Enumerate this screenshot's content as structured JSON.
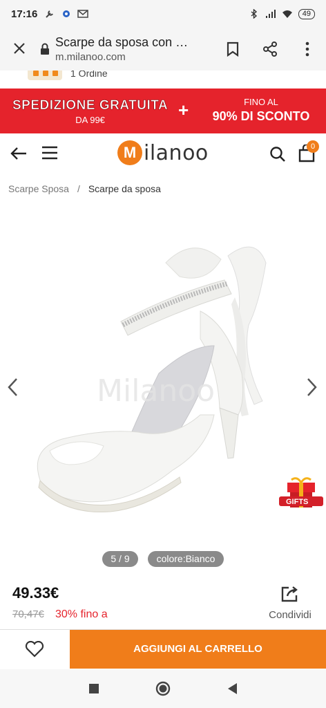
{
  "status_bar": {
    "time": "17:16",
    "battery": "49"
  },
  "browser": {
    "page_title": "Scarpe da sposa con …",
    "domain": "m.milanoo.com"
  },
  "strip": {
    "text": "1 Ordine"
  },
  "promo": {
    "free_shipping": "SPEDIZIONE GRATUITA",
    "threshold": "DA 99€",
    "plus": "+",
    "up_to": "FINO AL",
    "discount": "90% DI SCONTO"
  },
  "header": {
    "logo_text": "ilanoo"
  },
  "breadcrumb": {
    "items": [
      "Scarpe Sposa",
      "/",
      "Scarpe da sposa"
    ]
  },
  "gallery": {
    "counter": "5 / 9",
    "color_label": "colore:Bianco",
    "gifts_label": "GIFTS"
  },
  "product": {
    "price": "49.33€",
    "old_price": "70,47€",
    "discount": "30% fino a",
    "share_label": "Condividi"
  },
  "actions": {
    "add_to_cart": "AGGIUNGI AL CARRELLO"
  },
  "colors": {
    "brand_orange": "#f07d1a",
    "promo_red": "#e5232c"
  }
}
